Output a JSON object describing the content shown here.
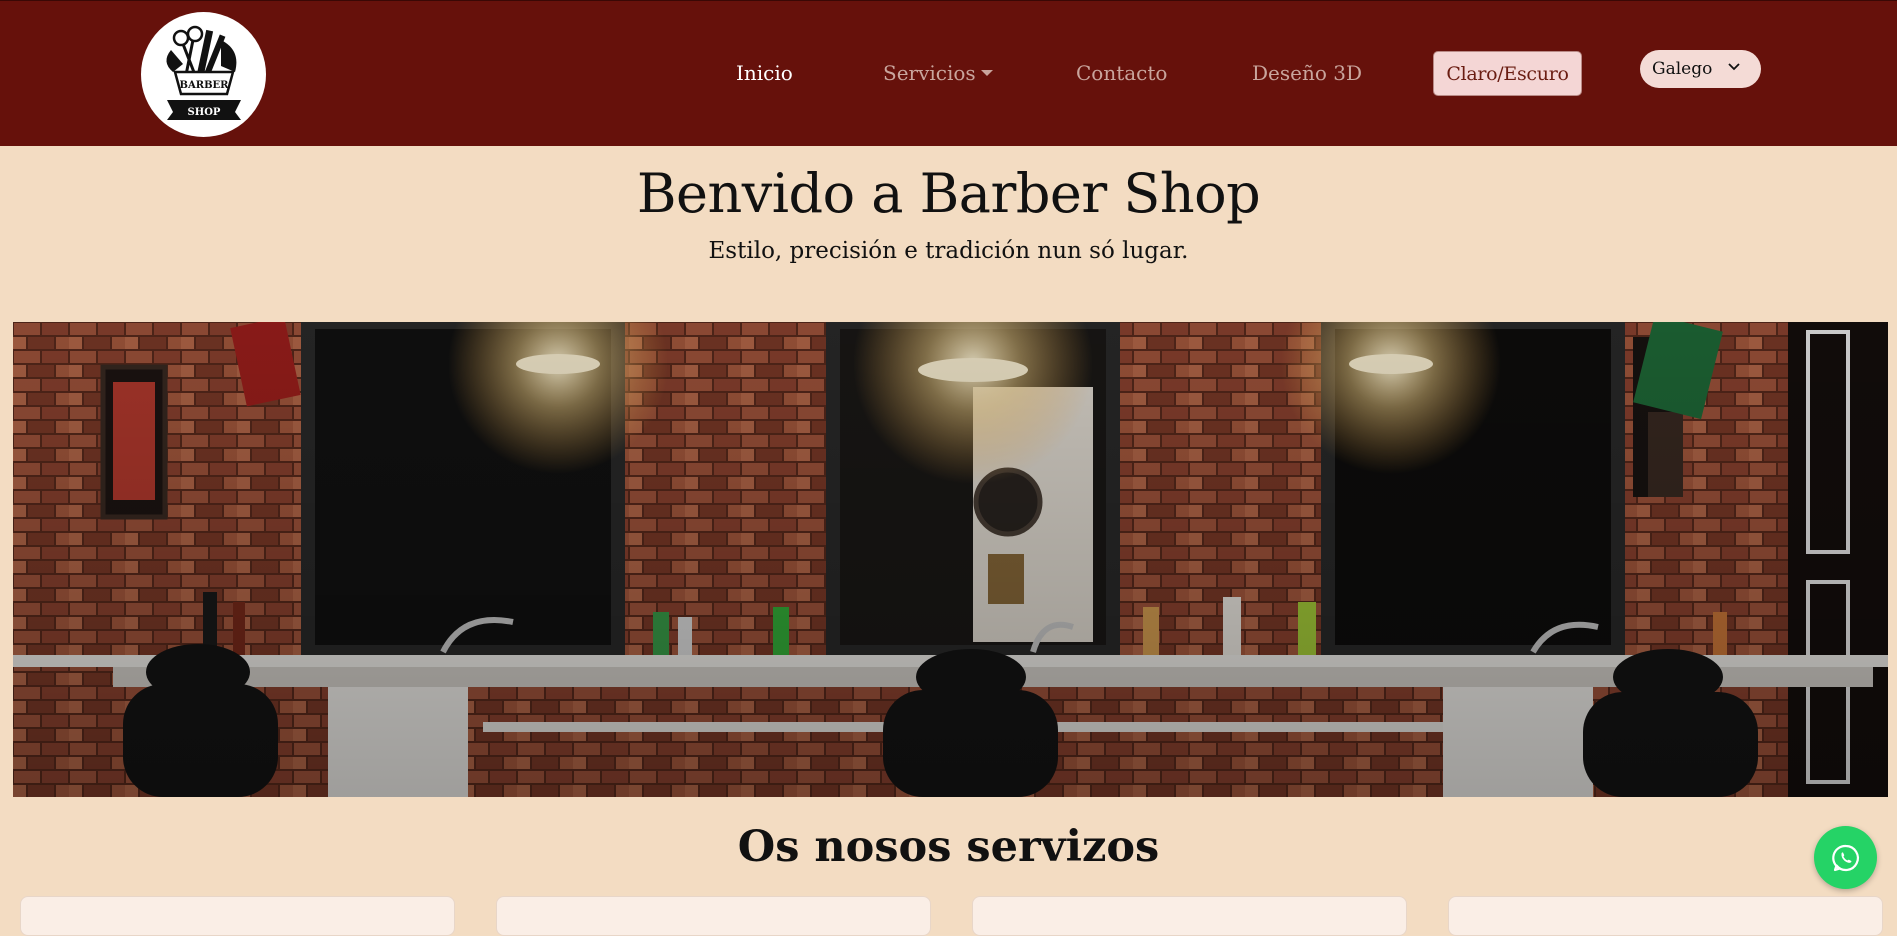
{
  "navbar": {
    "logo_alt": "Barber Shop",
    "logo_text_top": "BARBER",
    "logo_text_bottom": "SHOP",
    "links": [
      {
        "label": "Inicio",
        "active": true
      },
      {
        "label": "Servicios",
        "dropdown": true
      },
      {
        "label": "Contacto"
      },
      {
        "label": "Deseño 3D"
      }
    ],
    "theme_toggle": "Claro/Escuro",
    "language": {
      "selected": "Galego"
    }
  },
  "hero": {
    "title": "Benvido a Barber Shop",
    "subtitle": "Estilo, precisión e tradición nun só lugar."
  },
  "services": {
    "title": "Os nosos servizos",
    "card_count": 4
  },
  "floating": {
    "whatsapp_icon": "whatsapp-icon"
  },
  "colors": {
    "navbar_bg": "#66110b",
    "page_bg": "#f3dcc2",
    "theme_button_bg": "#f4d6d5",
    "whatsapp_green": "#25d366"
  }
}
